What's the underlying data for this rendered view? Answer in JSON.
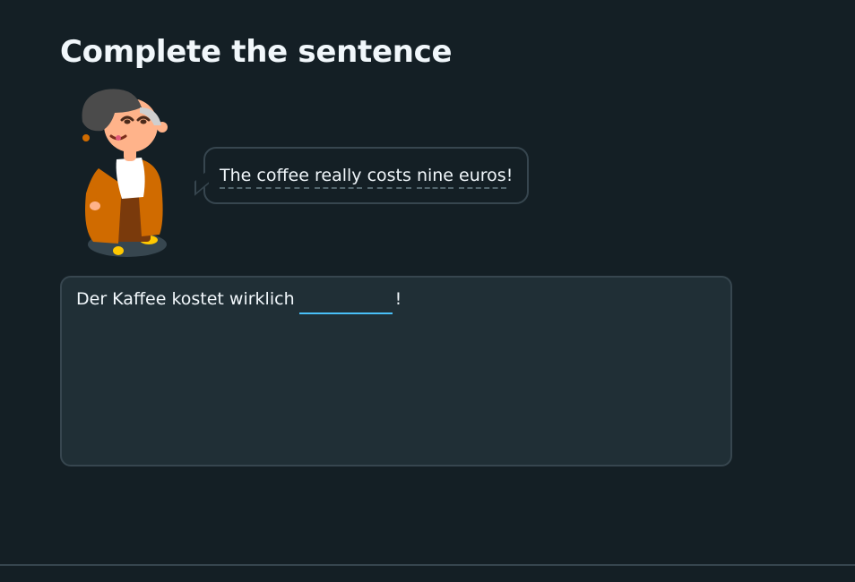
{
  "challenge": {
    "title": "Complete the sentence"
  },
  "speech": {
    "words": [
      "The",
      "coffee",
      "really",
      "costs",
      "nine",
      "euros"
    ],
    "end_punct": "!"
  },
  "sentence": {
    "before_blank": "Der Kaffee kostet wirklich",
    "input_value": "",
    "after_blank": "!"
  },
  "colors": {
    "background": "#141f25",
    "card": "#202f36",
    "border": "#37464f",
    "input_underline": "#49c0f8",
    "text": "#f1f7fb"
  },
  "icons": {
    "character": "character-lily-icon"
  }
}
